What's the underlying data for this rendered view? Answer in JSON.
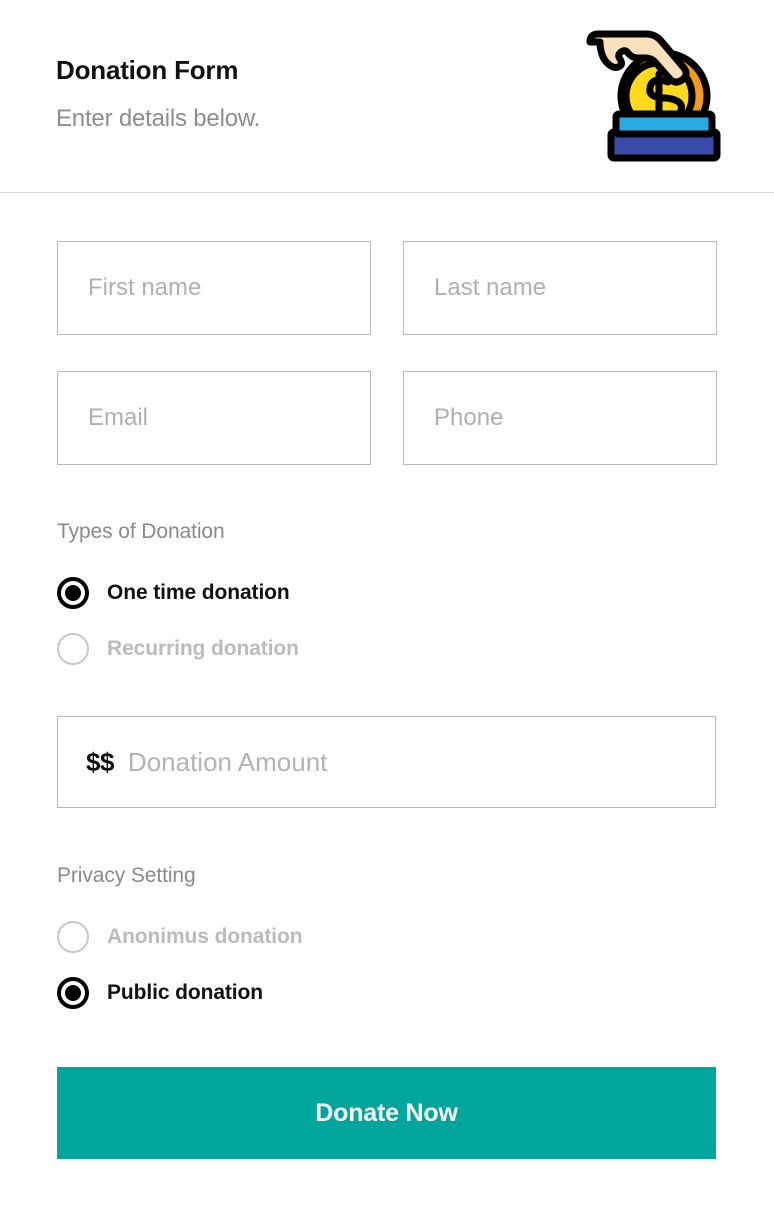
{
  "header": {
    "title": "Donation Form",
    "subtitle": "Enter details below.",
    "illustration_name": "hand-dropping-coin-into-donation-box-icon",
    "illustration_colors": {
      "skin": "#fbe0bc",
      "coin_face": "#ffd91c",
      "coin_rim": "#f5981e",
      "box_top_band": "#29abe2",
      "box_body": "#3b4ba8",
      "outline": "#000000"
    }
  },
  "form": {
    "fields": [
      {
        "name": "first-name",
        "placeholder": "First name",
        "value": ""
      },
      {
        "name": "last-name",
        "placeholder": "Last name",
        "value": ""
      },
      {
        "name": "email",
        "placeholder": "Email",
        "value": ""
      },
      {
        "name": "phone",
        "placeholder": "Phone",
        "value": ""
      }
    ],
    "donation_type": {
      "label": "Types of Donation",
      "options": [
        {
          "label": "One time donation",
          "selected": true
        },
        {
          "label": "Recurring donation",
          "selected": false
        }
      ]
    },
    "amount": {
      "prefix": "$$",
      "placeholder": "Donation Amount",
      "value": ""
    },
    "privacy": {
      "label": "Privacy Setting",
      "options": [
        {
          "label": "Anonimus donation",
          "selected": false
        },
        {
          "label": "Public donation",
          "selected": true
        }
      ]
    },
    "submit": {
      "label": "Donate Now",
      "color": "#00a69c"
    }
  }
}
